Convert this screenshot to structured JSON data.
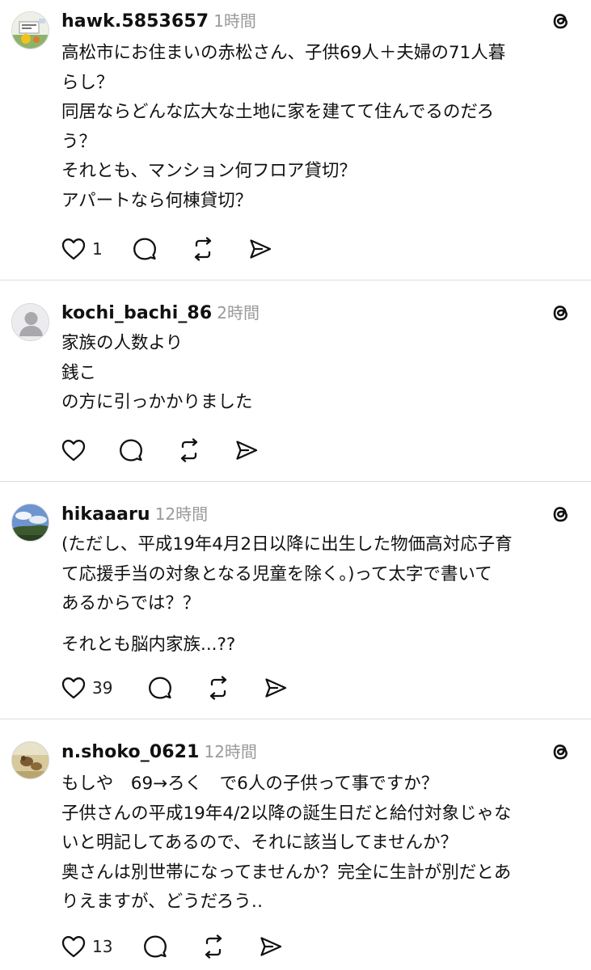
{
  "posts": [
    {
      "username": "hawk.5853657",
      "time": "1時間",
      "lines": [
        "高松市にお住まいの赤松さん、子供69人＋夫婦の71人暮",
        "らし？",
        "同居ならどんな広大な土地に家を建てて住んでるのだろ",
        "う？",
        "それとも、マンション何フロア貸切？",
        "アパートなら何棟貸切？"
      ],
      "likes": "1"
    },
    {
      "username": "kochi_bachi_86",
      "time": "2時間",
      "lines": [
        "家族の人数より",
        "銭こ",
        "の方に引っかかりました"
      ],
      "likes": ""
    },
    {
      "username": "hikaaaru",
      "time": "12時間",
      "lines": [
        "(ただし、平成19年4月2日以降に出生した物価高対応子育",
        "て応援手当の対象となる児童を除く。)って太字で書いて",
        "あるからでは？？"
      ],
      "extra_line": "それとも脳内家族...??",
      "likes": "39"
    },
    {
      "username": "n.shoko_0621",
      "time": "12時間",
      "lines": [
        "もしや　69→ろく　で6人の子供って事ですか？",
        "子供さんの平成19年4/2以降の誕生日だと給付対象じゃな",
        "いと明記してあるので、それに該当してませんか？",
        "奥さんは別世帯になってませんか？完全に生計が別だとあ",
        "りえますが、どうだろう‥"
      ],
      "likes": "13"
    }
  ],
  "icons": {
    "like": "heart-outline-icon",
    "reply": "comment-bubble-icon",
    "repost": "repost-arrows-icon",
    "share": "send-paper-plane-icon",
    "app": "threads-logo-icon"
  },
  "colors": {
    "text": "#111111",
    "muted": "#9a9a9a",
    "divider": "#dcdcdc"
  }
}
